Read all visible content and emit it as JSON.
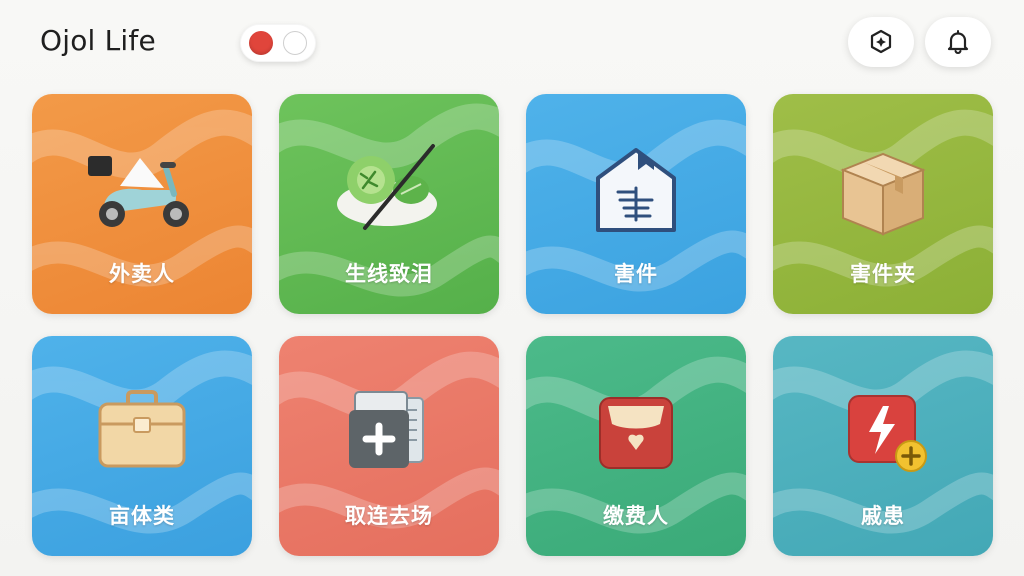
{
  "header": {
    "title": "Ojol Life",
    "toggle_state": "on",
    "toggle_color": "#e0453b",
    "actions": [
      {
        "icon": "scan-settings-icon"
      },
      {
        "icon": "bell-icon"
      }
    ]
  },
  "tiles": [
    {
      "label": "外卖人",
      "icon": "scooter-icon",
      "color": "#f08d3c"
    },
    {
      "label": "生线致泪",
      "icon": "vegetable-bowl-icon",
      "color": "#60b952"
    },
    {
      "label": "害件",
      "icon": "house-icon",
      "color": "#45aae6"
    },
    {
      "label": "害件夹",
      "icon": "package-box-icon",
      "color": "#96b73f"
    },
    {
      "label": "亩体类",
      "icon": "briefcase-icon",
      "color": "#45a9e4"
    },
    {
      "label": "取连去场",
      "icon": "medical-kit-icon",
      "color": "#e97966"
    },
    {
      "label": "缴费人",
      "icon": "wallet-icon",
      "color": "#43b282"
    },
    {
      "label": "戚患",
      "icon": "flash-add-icon",
      "color": "#4db0bd"
    }
  ]
}
